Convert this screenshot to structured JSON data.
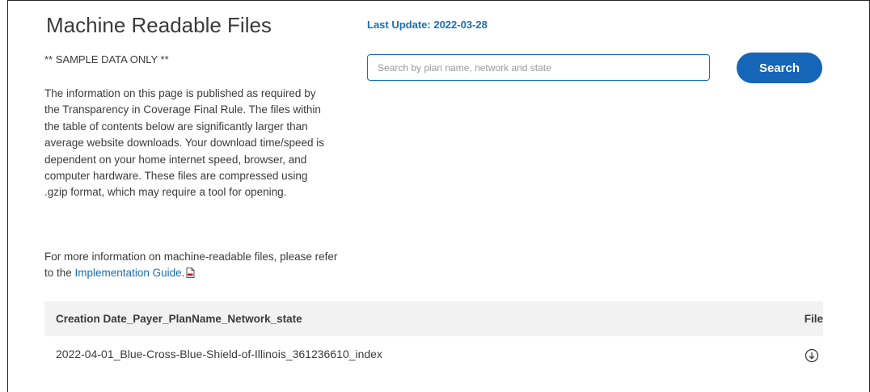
{
  "header": {
    "title": "Machine Readable Files",
    "last_update": "Last Update: 2022-03-28"
  },
  "notice": "** SAMPLE DATA ONLY **",
  "info": {
    "paragraph": "The information on this page is published as required by the Transparency in Coverage Final Rule. The files within the table of contents below are significantly larger than average website downloads. Your download time/speed is dependent on your home internet speed, browser, and computer hardware.  These files are compressed using .gzip format, which may require a tool for opening.",
    "more_prefix": "For more information on machine-readable files, please refer to the ",
    "link_label": "Implementation Guide",
    "more_suffix": ".",
    "pdf_icon": "pdf-icon"
  },
  "search": {
    "placeholder": "Search by plan name, network and state",
    "value": "",
    "button_label": "Search"
  },
  "table": {
    "columns": [
      "Creation Date_Payer_PlanName_Network_state",
      "File"
    ],
    "rows": [
      {
        "name": "2022-04-01_Blue-Cross-Blue-Shield-of-Illinois_361236610_index",
        "file_icon": "download-icon"
      }
    ]
  },
  "colors": {
    "accent": "#1a6fb5",
    "button": "#1565b8",
    "header_bg": "#f2f2f2"
  }
}
